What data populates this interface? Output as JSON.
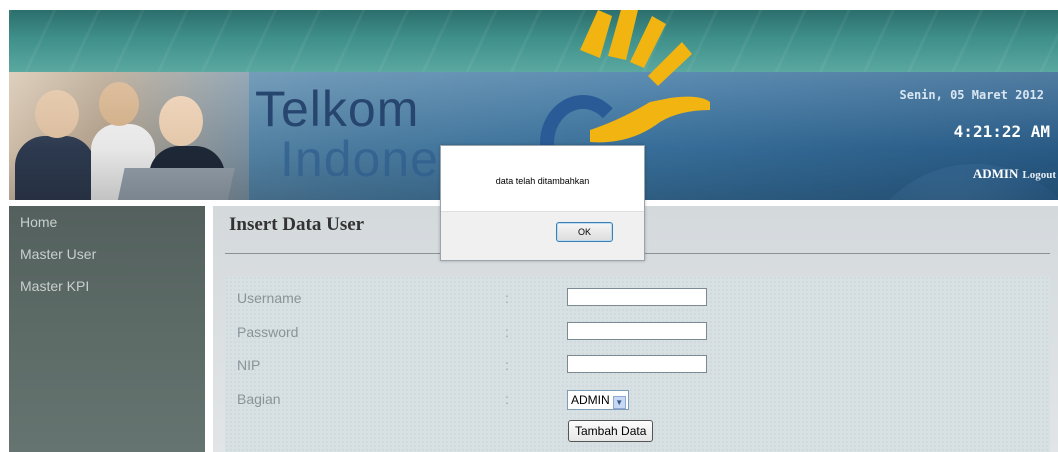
{
  "header": {
    "logo_line1": "Telkom",
    "logo_line2": "Indone",
    "date": "Senin, 05 Maret 2012",
    "time": "4:21:22 AM",
    "user": "ADMIN",
    "logout": "Logout"
  },
  "sidebar": {
    "items": [
      {
        "label": "Home"
      },
      {
        "label": "Master User"
      },
      {
        "label": "Master KPI"
      }
    ]
  },
  "main": {
    "title": "Insert Data User",
    "form": {
      "colon": ":",
      "fields": [
        {
          "label": "Username",
          "value": ""
        },
        {
          "label": "Password",
          "value": ""
        },
        {
          "label": "NIP",
          "value": ""
        },
        {
          "label": "Bagian",
          "selected": "ADMIN"
        }
      ],
      "submit_label": "Tambah Data"
    }
  },
  "dialog": {
    "message": "data telah ditambahkan",
    "ok_label": "OK"
  },
  "colors": {
    "header_blue": "#3a74a1",
    "sidebar_bg": "#5d6b67",
    "main_bg": "#d4d9dc",
    "teal_band": "#3f8f8a",
    "logo_yellow": "#f2b411"
  }
}
